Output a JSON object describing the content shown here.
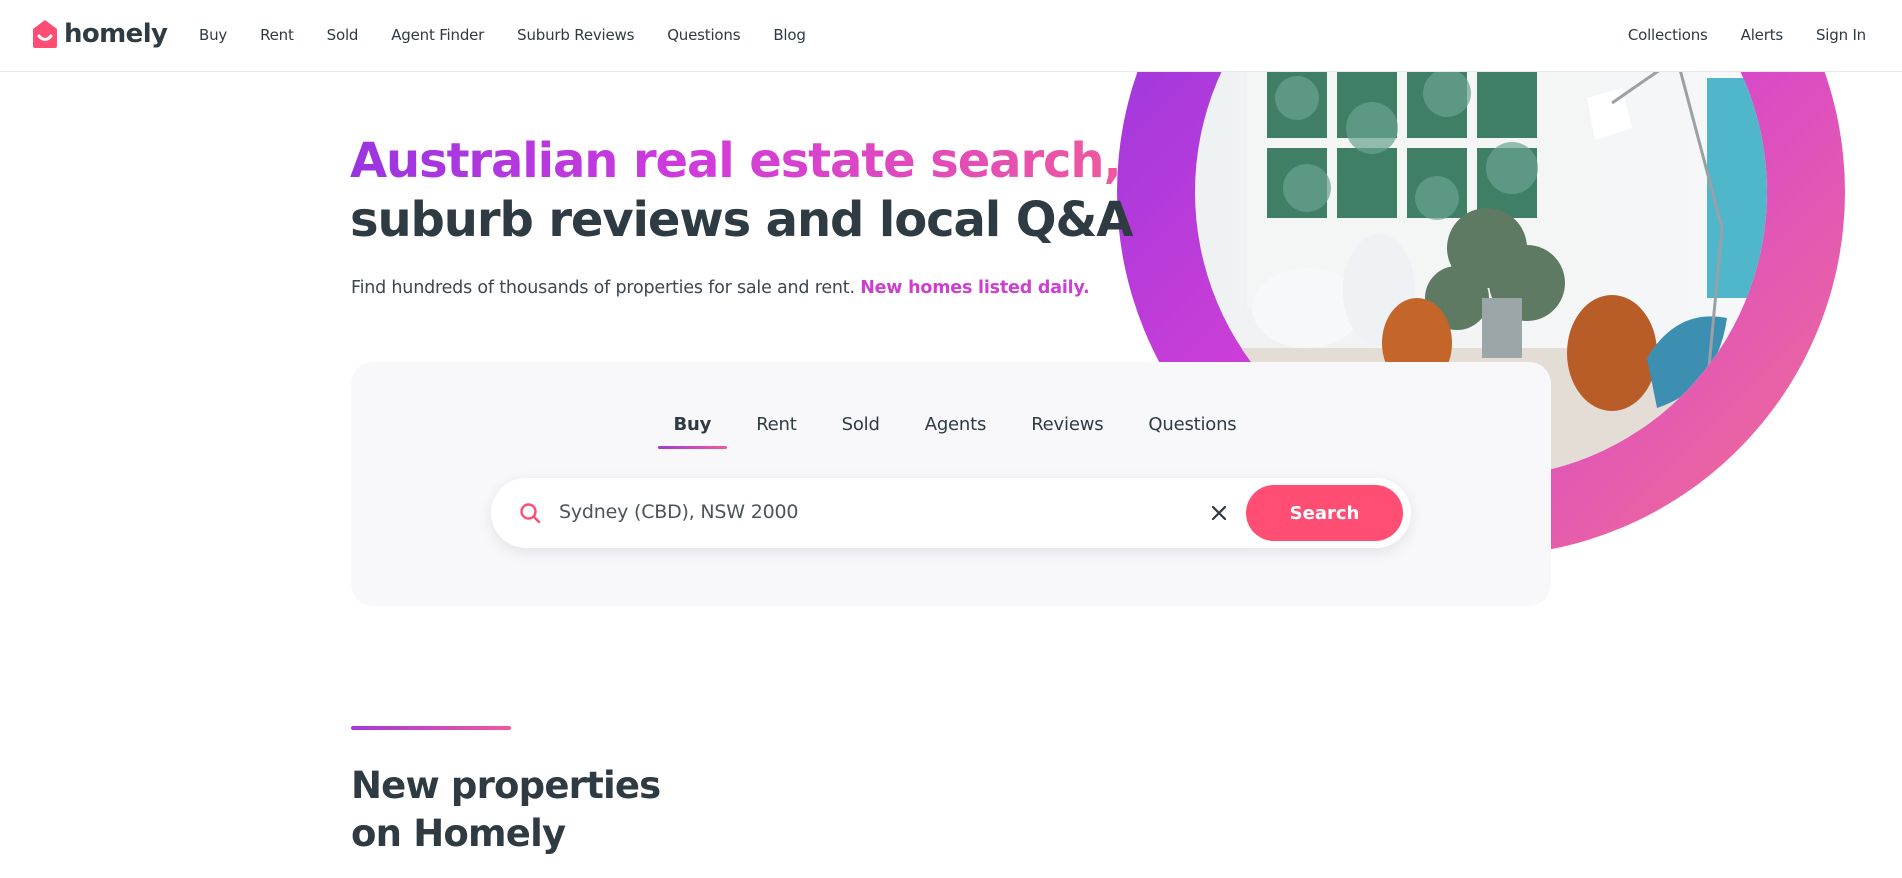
{
  "brand": {
    "name": "homely",
    "accent_color": "#ff4d74",
    "gradient": [
      "#9a35e0",
      "#d13bdc",
      "#ef5a9c"
    ]
  },
  "nav": {
    "left": [
      "Buy",
      "Rent",
      "Sold",
      "Agent Finder",
      "Suburb Reviews",
      "Questions",
      "Blog"
    ],
    "right": [
      "Collections",
      "Alerts",
      "Sign In"
    ]
  },
  "hero": {
    "headline_line1": "Australian real estate search,",
    "headline_line2": "suburb reviews and local Q&A",
    "subline": "Find hundreds of thousands of properties for sale and rent.",
    "subline_accent": "New homes listed daily."
  },
  "search": {
    "tabs": [
      "Buy",
      "Rent",
      "Sold",
      "Agents",
      "Reviews",
      "Questions"
    ],
    "active_tab": "Buy",
    "value": "Sydney (CBD), NSW 2000",
    "button_label": "Search",
    "icons": {
      "search": "search-icon",
      "clear": "close-icon"
    }
  },
  "section": {
    "title_line1": "New properties",
    "title_line2": "on Homely"
  }
}
